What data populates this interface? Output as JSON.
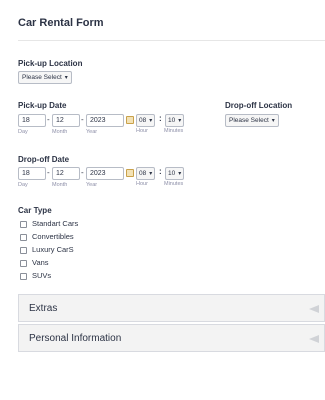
{
  "form": {
    "title": "Car Rental Form"
  },
  "pickup_location": {
    "label": "Pick-up Location",
    "select_value": "Please Select"
  },
  "pickup_date": {
    "label": "Pick-up Date",
    "day": "18",
    "month": "12",
    "year": "2023",
    "hour": "08",
    "minute": "10",
    "sub_day": "Day",
    "sub_month": "Month",
    "sub_year": "Year",
    "sub_hour": "Hour",
    "sub_minutes": "Minutes"
  },
  "dropoff_location": {
    "label": "Drop-off Location",
    "select_value": "Please Select"
  },
  "dropoff_date": {
    "label": "Drop-off Date",
    "day": "18",
    "month": "12",
    "year": "2023",
    "hour": "08",
    "minute": "10",
    "sub_day": "Day",
    "sub_month": "Month",
    "sub_year": "Year",
    "sub_hour": "Hour",
    "sub_minutes": "Minutes"
  },
  "car_type": {
    "label": "Car Type",
    "options": [
      "Standart Cars",
      "Convertibles",
      "Luxury CarS",
      "Vans",
      "SUVs"
    ]
  },
  "sections": {
    "extras": "Extras",
    "personal_information": "Personal Information"
  },
  "separators": {
    "dash": "-",
    "colon": ":"
  },
  "icons": {
    "dropdown": "chevron-down-icon",
    "calendar": "calendar-icon",
    "collapse": "collapse-arrow-icon"
  }
}
